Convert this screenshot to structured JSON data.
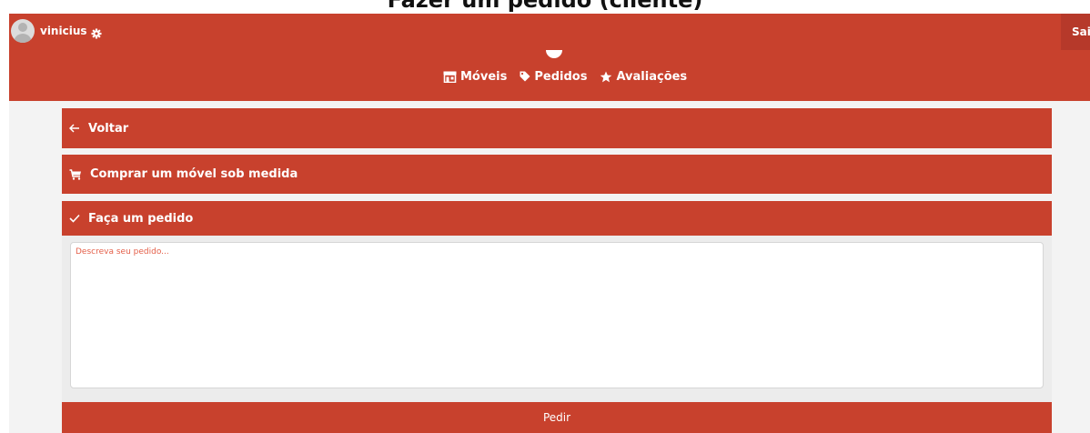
{
  "page": {
    "heading": "Fazer um pedido (cliente)"
  },
  "header": {
    "username": "vinicius",
    "exit_label": "Sair"
  },
  "nav": {
    "items": [
      {
        "label": "Móveis",
        "icon": "store-icon"
      },
      {
        "label": "Pedidos",
        "icon": "tag-icon"
      },
      {
        "label": "Avaliações",
        "icon": "star-icon"
      }
    ]
  },
  "sections": {
    "back_label": "Voltar",
    "buy_label": "Comprar um móvel sob medida",
    "order_label": "Faça um pedido"
  },
  "form": {
    "description_placeholder": "Descreva seu pedido...",
    "description_value": "",
    "submit_label": "Pedir"
  },
  "colors": {
    "primary": "#c8412d",
    "placeholder": "#e4604a",
    "background": "#f3f3f3"
  }
}
